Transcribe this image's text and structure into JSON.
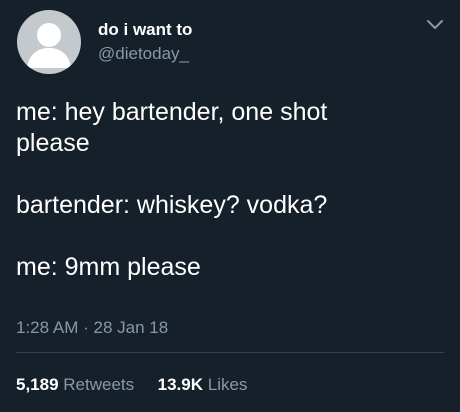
{
  "tweet": {
    "display_name": "do i want to",
    "handle": "@dietoday_",
    "lines": [
      "me: hey bartender, one shot",
      "please",
      "bartender: whiskey? vodka?",
      "me: 9mm please"
    ],
    "time": "1:28 AM",
    "separator": "·",
    "date": "28 Jan 18",
    "retweets_count": "5,189",
    "retweets_label": "Retweets",
    "likes_count": "13.9K",
    "likes_label": "Likes"
  },
  "colors": {
    "background": "#15202b",
    "primary_text": "#ffffff",
    "secondary_text": "#8899a6",
    "divider": "#38444d",
    "avatar_bg": "#c4c9cd",
    "avatar_fg": "#ffffff"
  },
  "icons": {
    "avatar": "default-profile-icon",
    "menu": "chevron-down-icon"
  }
}
